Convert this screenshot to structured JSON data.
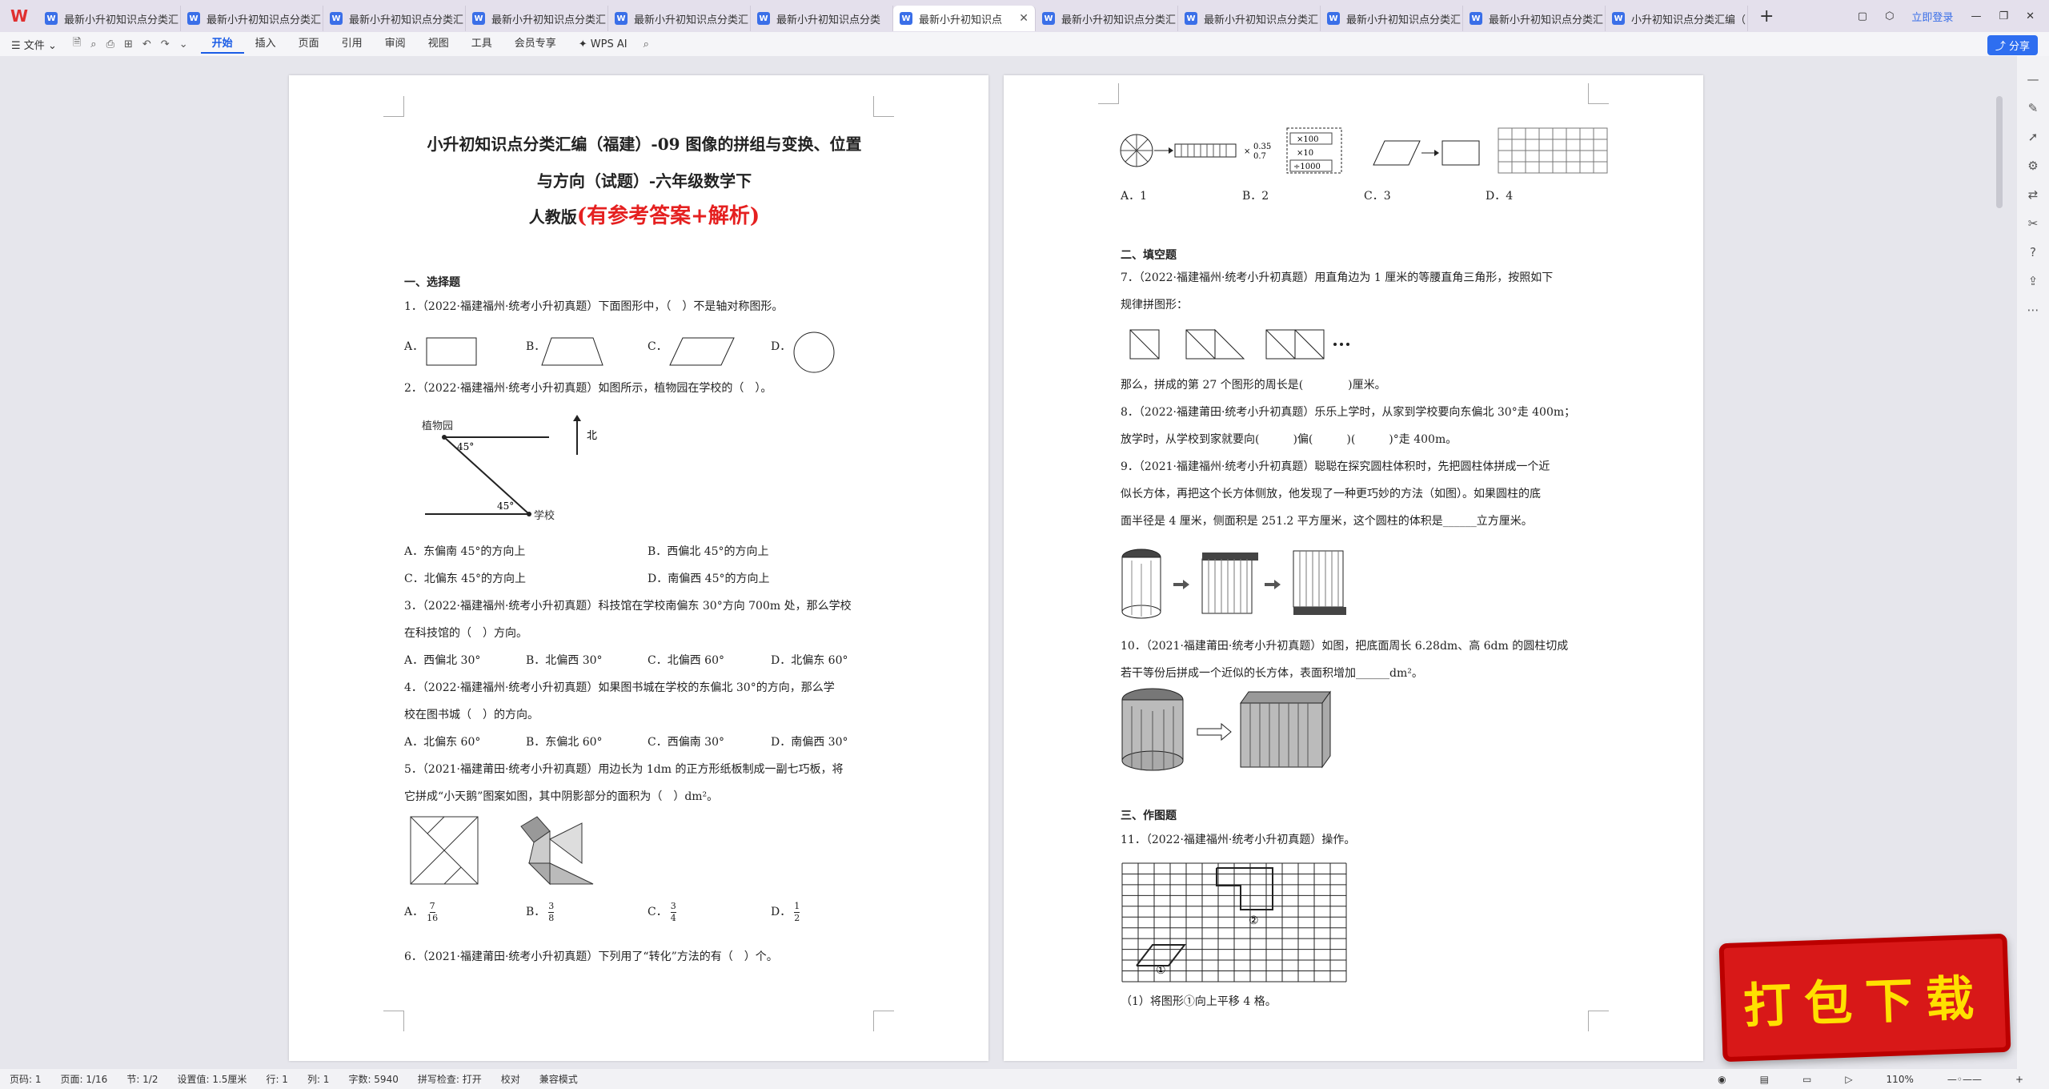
{
  "tabs": [
    "最新小升初知识点分类汇",
    "最新小升初知识点分类汇",
    "最新小升初知识点分类汇",
    "最新小升初知识点分类汇",
    "最新小升初知识点分类汇",
    "最新小升初知识点分类",
    "最新小升初知识点",
    "最新小升初知识点分类汇",
    "最新小升初知识点分类汇",
    "最新小升初知识点分类汇",
    "最新小升初知识点分类汇",
    "小升初知识点分类汇编（"
  ],
  "login": "立即登录",
  "menu": {
    "file": "文件",
    "items": [
      "开始",
      "插入",
      "页面",
      "引用",
      "审阅",
      "视图",
      "工具",
      "会员专享"
    ],
    "ai": "WPS AI",
    "share": "分享"
  },
  "page1": {
    "title1": "小升初知识点分类汇编（福建）-09 图像的拼组与变换、位置",
    "title2": "与方向（试题）-六年级数学下",
    "title3a": "人教版",
    "title3b": "(有参考答案+解析)",
    "sec1": "一、选择题",
    "q1": "1．（2022·福建福州·统考小升初真题）下面图形中，（　）不是轴对称图形。",
    "q1opts": [
      "A．",
      "B．",
      "C．",
      "D．"
    ],
    "q2": "2．（2022·福建福州·统考小升初真题）如图所示，植物园在学校的（　）。",
    "q2fig": {
      "garden": "植物园",
      "north": "北",
      "school": "学校",
      "a1": "45°",
      "a2": "45°"
    },
    "q2a": "A．东偏南 45°的方向上",
    "q2b": "B．西偏北 45°的方向上",
    "q2c": "C．北偏东 45°的方向上",
    "q2d": "D．南偏西 45°的方向上",
    "q3a": "3．（2022·福建福州·统考小升初真题）科技馆在学校南偏东 30°方向 700m 处，那么学校",
    "q3b": "在科技馆的（　）方向。",
    "q3opts": [
      "A．西偏北 30°",
      "B．北偏西 30°",
      "C．北偏西 60°",
      "D．北偏东 60°"
    ],
    "q4a": "4．（2022·福建福州·统考小升初真题）如果图书城在学校的东偏北 30°的方向，那么学",
    "q4b": "校在图书城（　）的方向。",
    "q4opts": [
      "A．北偏东 60°",
      "B．东偏北 60°",
      "C．西偏南 30°",
      "D．南偏西 30°"
    ],
    "q5a": "5．（2021·福建莆田·统考小升初真题）用边长为 1dm 的正方形纸板制成一副七巧板，将",
    "q5b": "它拼成“小天鹅”图案如图，其中阴影部分的面积为（　）dm²。",
    "q5opts": [
      {
        "l": "A．",
        "n": "7",
        "d": "16"
      },
      {
        "l": "B．",
        "n": "3",
        "d": "8"
      },
      {
        "l": "C．",
        "n": "3",
        "d": "4"
      },
      {
        "l": "D．",
        "n": "1",
        "d": "2"
      }
    ],
    "q6": "6．（2021·福建莆田·统考小升初真题）下列用了“转化”方法的有（　）个。"
  },
  "page2": {
    "optsTop": [
      "A．1",
      "B．2",
      "C．3",
      "D．4"
    ],
    "fig6": {
      "a": "0.35",
      "b": "0.7",
      "c": "×100",
      "d": "×10",
      "e": "÷1000",
      "f": "×"
    },
    "sec2": "二、填空题",
    "q7a": "7．（2022·福建福州·统考小升初真题）用直角边为 1 厘米的等腰直角三角形，按照如下",
    "q7b": "规律拼图形：",
    "q7c": "那么，拼成的第 27 个图形的周长是(　　　　)厘米。",
    "q8a": "8．（2022·福建莆田·统考小升初真题）乐乐上学时，从家到学校要向东偏北 30°走 400m；",
    "q8b": "放学时，从学校到家就要向(　　　)偏(　　　)(　　　)°走 400m。",
    "q9a": "9．（2021·福建福州·统考小升初真题）聪聪在探究圆柱体积时，先把圆柱体拼成一个近",
    "q9b": "似长方体，再把这个长方体侧放，他发现了一种更巧妙的方法（如图）。如果圆柱的底",
    "q9c": "面半径是 4 厘米，侧面积是 251.2 平方厘米，这个圆柱的体积是______立方厘米。",
    "q10a": "10．（2021·福建莆田·统考小升初真题）如图，把底面周长 6.28dm、高 6dm 的圆柱切成",
    "q10b": "若干等份后拼成一个近似的长方体，表面积增加______dm²。",
    "sec3": "三、作图题",
    "q11": "11．（2022·福建福州·统考小升初真题）操作。",
    "q11fig": {
      "m1": "①",
      "m2": "②"
    },
    "q11a": "（1）将图形①向上平移 4 格。"
  },
  "status": {
    "page": "页码: 1",
    "pages": "页面: 1/16",
    "sect": "节: 1/2",
    "set": "设置值: 1.5厘米",
    "row": "行: 1",
    "col": "列: 1",
    "words": "字数: 5940",
    "spell": "拼写检查: 打开",
    "proof": "校对",
    "compat": "兼容模式",
    "zoom": "110%"
  },
  "stamp": "打包下载"
}
